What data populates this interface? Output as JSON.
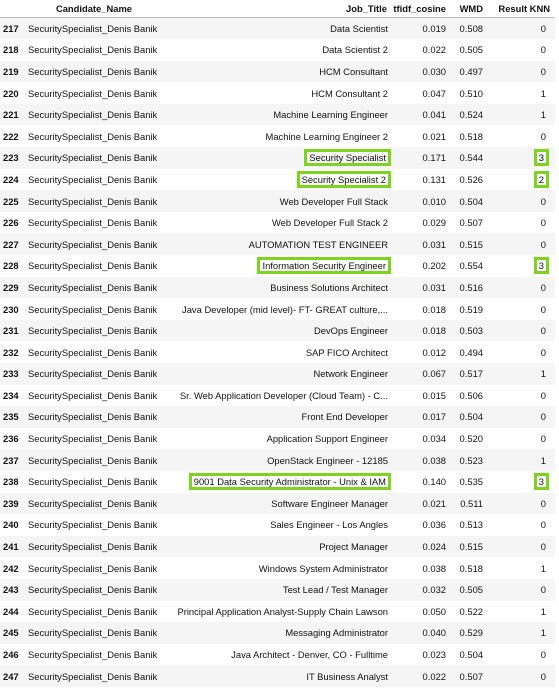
{
  "table": {
    "columns": [
      "",
      "Candidate_Name",
      "Job_Title",
      "tfidf_cosine",
      "WMD",
      "Result KNN"
    ],
    "highlight_color": "#7ed321",
    "rows": [
      {
        "idx": "217",
        "candidate": "SecuritySpecialist_Denis Banik",
        "job": "Data Scientist",
        "tfidf": "0.019",
        "wmd": "0.508",
        "knn": "0",
        "highlight": false
      },
      {
        "idx": "218",
        "candidate": "SecuritySpecialist_Denis Banik",
        "job": "Data Scientist 2",
        "tfidf": "0.022",
        "wmd": "0.505",
        "knn": "0",
        "highlight": false
      },
      {
        "idx": "219",
        "candidate": "SecuritySpecialist_Denis Banik",
        "job": "HCM Consultant",
        "tfidf": "0.030",
        "wmd": "0.497",
        "knn": "0",
        "highlight": false
      },
      {
        "idx": "220",
        "candidate": "SecuritySpecialist_Denis Banik",
        "job": "HCM Consultant 2",
        "tfidf": "0.047",
        "wmd": "0.510",
        "knn": "1",
        "highlight": false
      },
      {
        "idx": "221",
        "candidate": "SecuritySpecialist_Denis Banik",
        "job": "Machine Learning Engineer",
        "tfidf": "0.041",
        "wmd": "0.524",
        "knn": "1",
        "highlight": false
      },
      {
        "idx": "222",
        "candidate": "SecuritySpecialist_Denis Banik",
        "job": "Machine Learning Engineer 2",
        "tfidf": "0.021",
        "wmd": "0.518",
        "knn": "0",
        "highlight": false
      },
      {
        "idx": "223",
        "candidate": "SecuritySpecialist_Denis Banik",
        "job": "Security Specialist",
        "tfidf": "0.171",
        "wmd": "0.544",
        "knn": "3",
        "highlight": true
      },
      {
        "idx": "224",
        "candidate": "SecuritySpecialist_Denis Banik",
        "job": "Security Specialist 2",
        "tfidf": "0.131",
        "wmd": "0.526",
        "knn": "2",
        "highlight": true
      },
      {
        "idx": "225",
        "candidate": "SecuritySpecialist_Denis Banik",
        "job": "Web Developer Full Stack",
        "tfidf": "0.010",
        "wmd": "0.504",
        "knn": "0",
        "highlight": false
      },
      {
        "idx": "226",
        "candidate": "SecuritySpecialist_Denis Banik",
        "job": "Web Developer Full Stack 2",
        "tfidf": "0.029",
        "wmd": "0.507",
        "knn": "0",
        "highlight": false
      },
      {
        "idx": "227",
        "candidate": "SecuritySpecialist_Denis Banik",
        "job": "AUTOMATION TEST ENGINEER",
        "tfidf": "0.031",
        "wmd": "0.515",
        "knn": "0",
        "highlight": false
      },
      {
        "idx": "228",
        "candidate": "SecuritySpecialist_Denis Banik",
        "job": "Information Security Engineer",
        "tfidf": "0.202",
        "wmd": "0.554",
        "knn": "3",
        "highlight": true
      },
      {
        "idx": "229",
        "candidate": "SecuritySpecialist_Denis Banik",
        "job": "Business Solutions Architect",
        "tfidf": "0.031",
        "wmd": "0.516",
        "knn": "0",
        "highlight": false
      },
      {
        "idx": "230",
        "candidate": "SecuritySpecialist_Denis Banik",
        "job": "Java Developer (mid level)- FT- GREAT culture,...",
        "tfidf": "0.018",
        "wmd": "0.519",
        "knn": "0",
        "highlight": false
      },
      {
        "idx": "231",
        "candidate": "SecuritySpecialist_Denis Banik",
        "job": "DevOps Engineer",
        "tfidf": "0.018",
        "wmd": "0.503",
        "knn": "0",
        "highlight": false
      },
      {
        "idx": "232",
        "candidate": "SecuritySpecialist_Denis Banik",
        "job": "SAP FICO Architect",
        "tfidf": "0.012",
        "wmd": "0.494",
        "knn": "0",
        "highlight": false
      },
      {
        "idx": "233",
        "candidate": "SecuritySpecialist_Denis Banik",
        "job": "Network Engineer",
        "tfidf": "0.067",
        "wmd": "0.517",
        "knn": "1",
        "highlight": false
      },
      {
        "idx": "234",
        "candidate": "SecuritySpecialist_Denis Banik",
        "job": "Sr. Web Application Developer (Cloud Team) - C...",
        "tfidf": "0.015",
        "wmd": "0.506",
        "knn": "0",
        "highlight": false
      },
      {
        "idx": "235",
        "candidate": "SecuritySpecialist_Denis Banik",
        "job": "Front End Developer",
        "tfidf": "0.017",
        "wmd": "0.504",
        "knn": "0",
        "highlight": false
      },
      {
        "idx": "236",
        "candidate": "SecuritySpecialist_Denis Banik",
        "job": "Application Support Engineer",
        "tfidf": "0.034",
        "wmd": "0.520",
        "knn": "0",
        "highlight": false
      },
      {
        "idx": "237",
        "candidate": "SecuritySpecialist_Denis Banik",
        "job": "OpenStack Engineer - 12185",
        "tfidf": "0.038",
        "wmd": "0.523",
        "knn": "1",
        "highlight": false
      },
      {
        "idx": "238",
        "candidate": "SecuritySpecialist_Denis Banik",
        "job": "9001 Data Security Administrator - Unix & IAM",
        "tfidf": "0.140",
        "wmd": "0.535",
        "knn": "3",
        "highlight": true
      },
      {
        "idx": "239",
        "candidate": "SecuritySpecialist_Denis Banik",
        "job": "Software Engineer Manager",
        "tfidf": "0.021",
        "wmd": "0.511",
        "knn": "0",
        "highlight": false
      },
      {
        "idx": "240",
        "candidate": "SecuritySpecialist_Denis Banik",
        "job": "Sales Engineer - Los Angles",
        "tfidf": "0.036",
        "wmd": "0.513",
        "knn": "0",
        "highlight": false
      },
      {
        "idx": "241",
        "candidate": "SecuritySpecialist_Denis Banik",
        "job": "Project Manager",
        "tfidf": "0.024",
        "wmd": "0.515",
        "knn": "0",
        "highlight": false
      },
      {
        "idx": "242",
        "candidate": "SecuritySpecialist_Denis Banik",
        "job": "Windows System Administrator",
        "tfidf": "0.038",
        "wmd": "0.518",
        "knn": "1",
        "highlight": false
      },
      {
        "idx": "243",
        "candidate": "SecuritySpecialist_Denis Banik",
        "job": "Test Lead / Test Manager",
        "tfidf": "0.032",
        "wmd": "0.505",
        "knn": "0",
        "highlight": false
      },
      {
        "idx": "244",
        "candidate": "SecuritySpecialist_Denis Banik",
        "job": "Principal Application Analyst-Supply Chain Lawson",
        "tfidf": "0.050",
        "wmd": "0.522",
        "knn": "1",
        "highlight": false
      },
      {
        "idx": "245",
        "candidate": "SecuritySpecialist_Denis Banik",
        "job": "Messaging Administrator",
        "tfidf": "0.040",
        "wmd": "0.529",
        "knn": "1",
        "highlight": false
      },
      {
        "idx": "246",
        "candidate": "SecuritySpecialist_Denis Banik",
        "job": "Java Architect - Denver, CO - Fulltime",
        "tfidf": "0.023",
        "wmd": "0.504",
        "knn": "0",
        "highlight": false
      },
      {
        "idx": "247",
        "candidate": "SecuritySpecialist_Denis Banik",
        "job": "IT Business Analyst",
        "tfidf": "0.022",
        "wmd": "0.507",
        "knn": "0",
        "highlight": false
      }
    ]
  }
}
